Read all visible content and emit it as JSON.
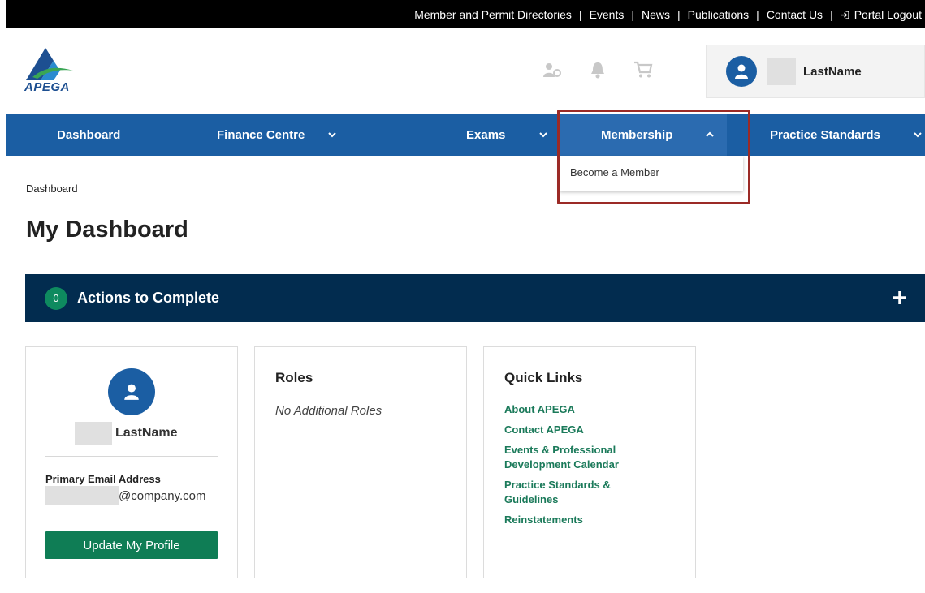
{
  "topbar": {
    "links": [
      "Member and Permit Directories",
      "Events",
      "News",
      "Publications",
      "Contact Us"
    ],
    "logout_label": "Portal Logout"
  },
  "header": {
    "logo_text": "APEGA",
    "user_name": "LastName"
  },
  "nav": {
    "items": [
      {
        "label": "Dashboard"
      },
      {
        "label": "Finance Centre"
      },
      {
        "label": "Exams"
      },
      {
        "label": "Membership"
      },
      {
        "label": "Practice Standards"
      }
    ],
    "dropdown_item": "Become a Member"
  },
  "breadcrumb": "Dashboard",
  "page_title": "My Dashboard",
  "actions": {
    "count": "0",
    "title": "Actions to Complete"
  },
  "profile": {
    "name": "LastName",
    "email_label": "Primary Email Address",
    "email_domain": "@company.com",
    "update_button": "Update My Profile"
  },
  "roles": {
    "title": "Roles",
    "text": "No Additional Roles"
  },
  "quick_links": {
    "title": "Quick Links",
    "links": [
      "About APEGA",
      "Contact APEGA",
      "Events & Professional Development Calendar",
      "Practice Standards & Guidelines",
      "Reinstatements"
    ]
  },
  "colors": {
    "nav_blue": "#1b5ea3",
    "actions_navy": "#022c4f",
    "accent_green": "#0f7d55",
    "highlight_red": "#9b2a26"
  }
}
